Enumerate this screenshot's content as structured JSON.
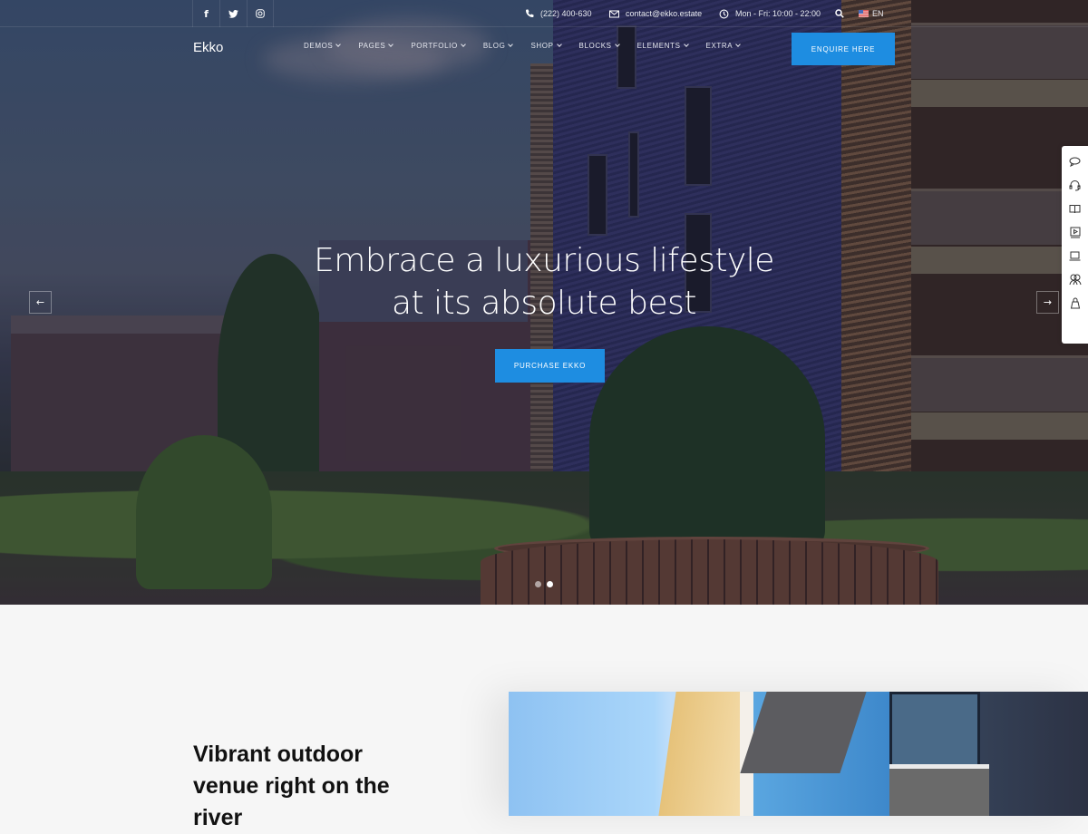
{
  "topbar": {
    "social": [
      {
        "icon": "facebook-icon",
        "glyph": "f"
      },
      {
        "icon": "twitter-icon",
        "glyph": "t"
      },
      {
        "icon": "instagram-icon",
        "glyph": "◎"
      }
    ],
    "phone": "(222) 400-630",
    "email": "contact@ekko.estate",
    "hours": "Mon - Fri: 10:00 - 22:00",
    "language": "EN"
  },
  "header": {
    "logo": "Ekko",
    "nav": [
      {
        "label": "DEMOS"
      },
      {
        "label": "PAGES"
      },
      {
        "label": "PORTFOLIO"
      },
      {
        "label": "BLOG"
      },
      {
        "label": "SHOP"
      },
      {
        "label": "BLOCKS"
      },
      {
        "label": "ELEMENTS"
      },
      {
        "label": "EXTRA"
      }
    ],
    "cta_label": "ENQUIRE HERE"
  },
  "hero": {
    "headline_line1": "Embrace a luxurious lifestyle",
    "headline_line2": "at its absolute best",
    "button_label": "PURCHASE EKKO",
    "prev_arrow": "←",
    "next_arrow": "→",
    "slides_total": 2,
    "active_slide": 2
  },
  "side_toolbar": {
    "items": [
      {
        "icon": "chat-icon"
      },
      {
        "icon": "headset-icon"
      },
      {
        "icon": "book-icon"
      },
      {
        "icon": "video-icon"
      },
      {
        "icon": "laptop-icon"
      },
      {
        "icon": "users-icon"
      },
      {
        "icon": "shopping-bag-icon"
      }
    ]
  },
  "section": {
    "title": "Vibrant outdoor venue right on the river"
  },
  "colors": {
    "accent": "#1e8de1",
    "page_bg": "#f6f6f6",
    "text_dark": "#111111"
  }
}
